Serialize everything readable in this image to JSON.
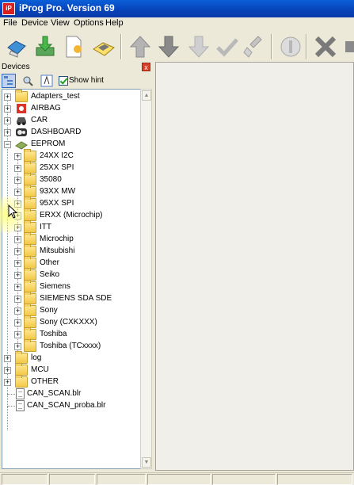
{
  "window": {
    "title": "iProg Pro. Version 69",
    "icon_text": "iP"
  },
  "menu": [
    "File",
    "Device",
    "View",
    "Options",
    "Help"
  ],
  "toolbar": {
    "buttons": [
      "connect-icon",
      "download-icon",
      "new-file-icon",
      "open-device-icon",
      "arrow-up-icon",
      "arrow-down-icon",
      "arrow-down-disabled-icon",
      "check-icon",
      "erase-icon",
      "circle-icon",
      "cancel-icon"
    ]
  },
  "devices_panel": {
    "title": "Devices",
    "close_label": "x",
    "show_hint_label": "Show hint",
    "show_hint_checked": true
  },
  "tree": {
    "root_items_top": [
      {
        "label": "Adapters_test",
        "icon": "folder-icon"
      },
      {
        "label": "AIRBAG",
        "icon": "airbag-icon"
      },
      {
        "label": "CAR",
        "icon": "car-icon"
      },
      {
        "label": "DASHBOARD",
        "icon": "dashboard-icon"
      },
      {
        "label": "EEPROM",
        "icon": "eeprom-icon"
      }
    ],
    "eeprom_children": [
      "24XX I2C",
      "25XX SPI",
      "35080",
      "93XX MW",
      "95XX SPI",
      "ERXX (Microchip)",
      "ITT",
      "Microchip",
      "Mitsubishi",
      "Other",
      "Seiko",
      "Siemens",
      "SIEMENS SDA SDE",
      "Sony",
      "Sony (CXKXXX)",
      "Toshiba",
      "Toshiba (TCxxxx)"
    ],
    "root_items_bottom": [
      {
        "label": "log",
        "icon": "folder-icon"
      },
      {
        "label": "MCU",
        "icon": "folder-icon"
      },
      {
        "label": "OTHER",
        "icon": "folder-icon"
      }
    ],
    "files": [
      "CAN_SCAN.blr",
      "CAN_SCAN_proba.blr"
    ]
  },
  "colors": {
    "titlebar": "#0842b8",
    "highlight": "#ffff78"
  }
}
